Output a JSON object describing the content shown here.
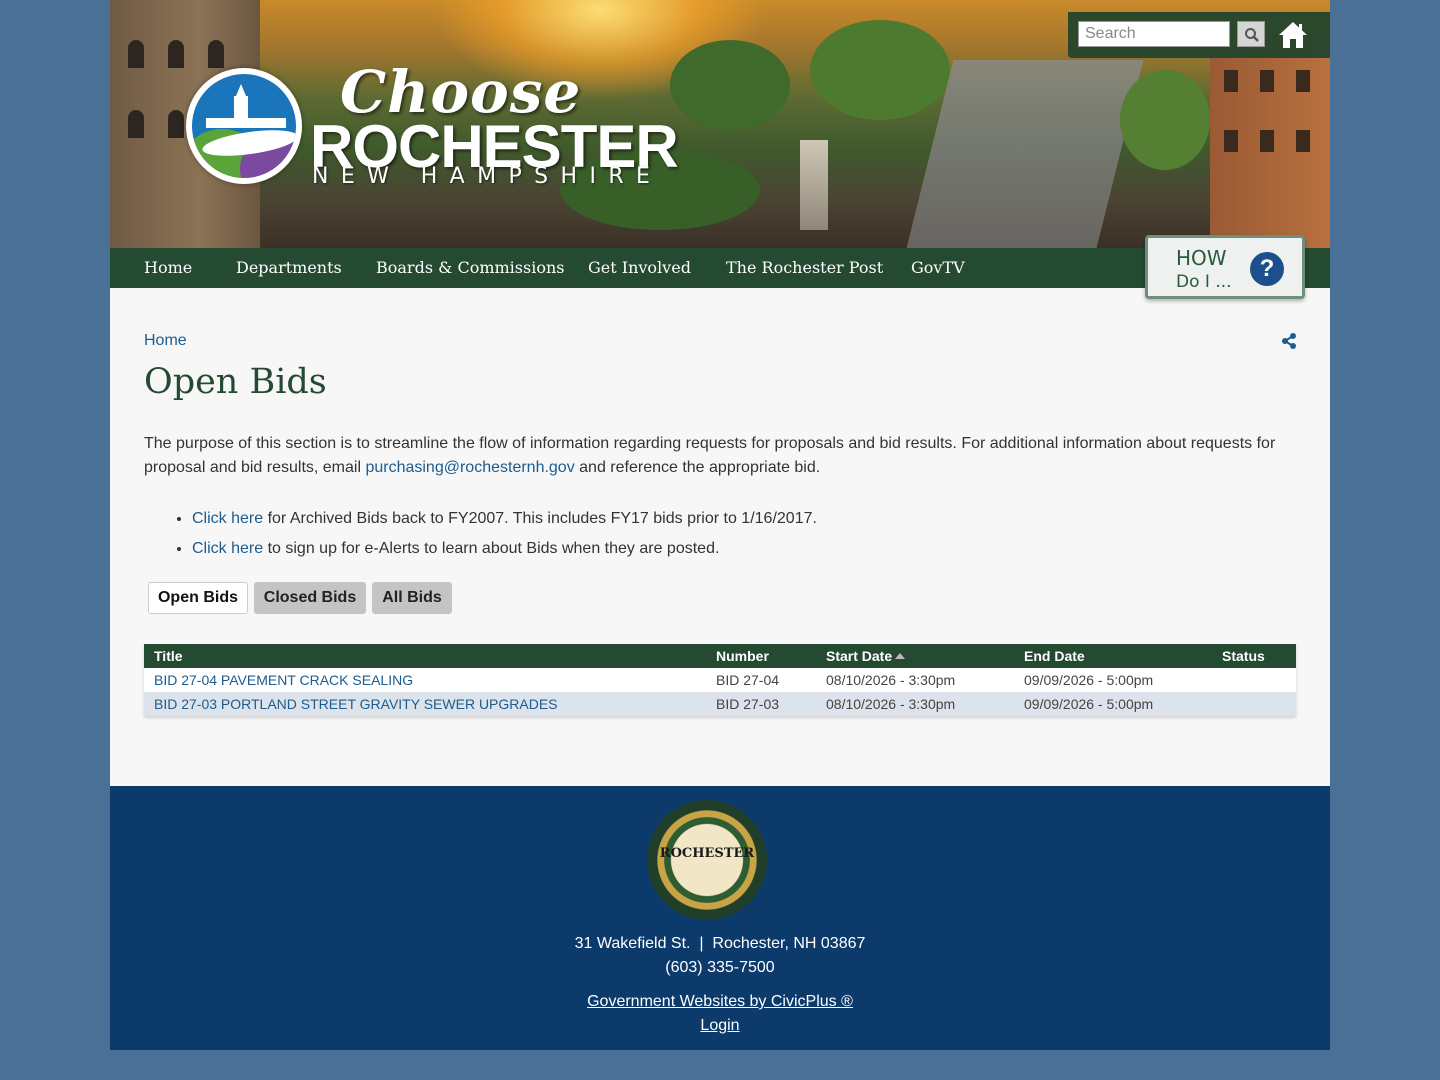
{
  "header": {
    "brand": {
      "line1": "Choose",
      "line2": "ROCHESTER",
      "line3": "NEW HAMPSHIRE"
    },
    "search": {
      "placeholder": "Search"
    },
    "icons": {
      "search": "search-icon",
      "home": "home-icon"
    }
  },
  "nav": {
    "items": [
      {
        "label": "Home"
      },
      {
        "label": "Departments"
      },
      {
        "label": "Boards & Commissions"
      },
      {
        "label": "Get Involved"
      },
      {
        "label": "The Rochester Post"
      },
      {
        "label": "GovTV"
      }
    ],
    "how_do_i": {
      "line1": "HOW",
      "line2": "Do I ...",
      "icon": "?"
    }
  },
  "breadcrumb": {
    "home": "Home"
  },
  "page": {
    "title": "Open Bids",
    "intro_text_1": "The purpose of this section is to streamline the flow of information regarding requests for proposals and bid results. For additional information about requests for proposal and bid results, email ",
    "intro_email": "purchasing@rochesternh.gov",
    "intro_text_2": " and reference the appropriate bid.",
    "bullets": [
      {
        "link": "Click here",
        "text": " for Archived Bids back to FY2007. This includes FY17 bids prior to 1/16/2017."
      },
      {
        "link": "Click here",
        "text": " to sign up for e-Alerts to learn about Bids when they are posted."
      }
    ]
  },
  "tabs": [
    {
      "label": "Open Bids",
      "active": true
    },
    {
      "label": "Closed Bids",
      "active": false
    },
    {
      "label": "All Bids",
      "active": false
    }
  ],
  "table": {
    "columns": [
      "Title",
      "Number",
      "Start Date",
      "End Date",
      "Status"
    ],
    "sorted_column": "Start Date",
    "rows": [
      {
        "title": "BID 27-04 PAVEMENT CRACK SEALING",
        "number": "BID 27-04",
        "start": "08/10/2026 - 3:30pm",
        "end": "09/09/2026 - 5:00pm",
        "status": ""
      },
      {
        "title": "BID 27-03 PORTLAND STREET GRAVITY SEWER UPGRADES",
        "number": "BID 27-03",
        "start": "08/10/2026 - 3:30pm",
        "end": "09/09/2026 - 5:00pm",
        "status": ""
      }
    ]
  },
  "footer": {
    "seal_text": "ROCHESTER",
    "address": "31 Wakefield St.  |  Rochester, NH 03867",
    "phone": "(603) 335-7500",
    "credit": "Government Websites by CivicPlus ®",
    "login": "Login"
  },
  "colors": {
    "background": "#4a7096",
    "nav": "#254a32",
    "link": "#1d5c8f",
    "footer": "#0b3a6b",
    "row_alt": "#dde3ea"
  }
}
